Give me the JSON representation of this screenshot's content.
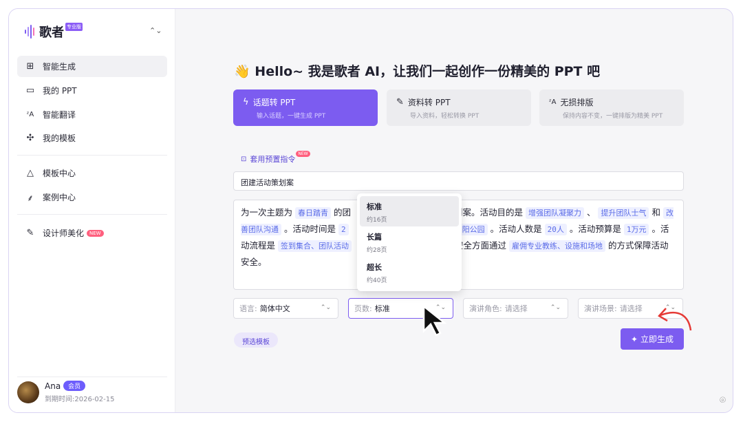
{
  "sidebar": {
    "brand": "歌者",
    "brand_badge": "专业版",
    "items": [
      {
        "icon": "grid-icon",
        "glyph": "⊞",
        "label": "智能生成"
      },
      {
        "icon": "monitor-icon",
        "glyph": "▭",
        "label": "我的 PPT"
      },
      {
        "icon": "translate-icon",
        "glyph": "ᶻA",
        "label": "智能翻译"
      },
      {
        "icon": "puzzle-icon",
        "glyph": "✣",
        "label": "我的模板"
      },
      {
        "icon": "shapes-icon",
        "glyph": "△",
        "label": "模板中心"
      },
      {
        "icon": "sparkle-brush-icon",
        "glyph": "⸙",
        "label": "案例中心"
      },
      {
        "icon": "brush-icon",
        "glyph": "✎",
        "label": "设计师美化",
        "badge": "NEW"
      }
    ],
    "user": {
      "name": "Ana",
      "badge": "会员",
      "expire": "到期时间:2026-02-15"
    }
  },
  "main": {
    "title": "Hello~ 我是歌者 AI，让我们一起创作一份精美的 PPT 吧",
    "wave_emoji": "👋",
    "modes": [
      {
        "label": "话题转 PPT",
        "sub": "输入话题，一键生成 PPT",
        "icon": "bolt-icon",
        "glyph": "ϟ"
      },
      {
        "label": "资料转 PPT",
        "sub": "导入资料，轻松转换 PPT",
        "icon": "file-edit-icon",
        "glyph": "✎"
      },
      {
        "label": "无损排版",
        "sub": "保持内容不变，一键排版为精美 PPT",
        "icon": "translate-icon",
        "glyph": "ᶻA"
      }
    ],
    "preset_label": "套用预置指令",
    "preset_badge": "NEW",
    "topic_value": "团建活动策划案",
    "prompt": {
      "p1": "为一次主题为",
      "t1": "春日踏青",
      "p2": "的团",
      "p3": "划案。活动目的是",
      "t2": "增强团队凝聚力",
      "p4": "、",
      "t3": "提升团队士气",
      "p5": "和",
      "t4": "改善团队沟通",
      "p6": "。活动时间是",
      "t5": "2",
      "t6": "朝阳公园",
      "p7": "。活动人数是",
      "t7": "20人",
      "p8": "。活动预算是",
      "t8": "1万元",
      "p9": "。活动流程是",
      "t9": "签到集合、团队活动",
      "p10": "安全方面通过",
      "t10": "雇佣专业教练、设施和场地",
      "p11": "的方式保障活动安全。"
    },
    "selects": {
      "language": {
        "label": "语言:",
        "value": "简体中文"
      },
      "pages": {
        "label": "页数:",
        "value": "标准"
      },
      "role": {
        "label": "演讲角色:",
        "placeholder": "请选择"
      },
      "scene": {
        "label": "演讲场景:",
        "placeholder": "请选择"
      }
    },
    "page_options": [
      {
        "label": "标准",
        "sub": "约16页"
      },
      {
        "label": "长篇",
        "sub": "约28页"
      },
      {
        "label": "超长",
        "sub": "约40页"
      }
    ],
    "preset_template_button": "预选模板",
    "generate_button": "立即生成",
    "accent": "#7c5cf0"
  }
}
